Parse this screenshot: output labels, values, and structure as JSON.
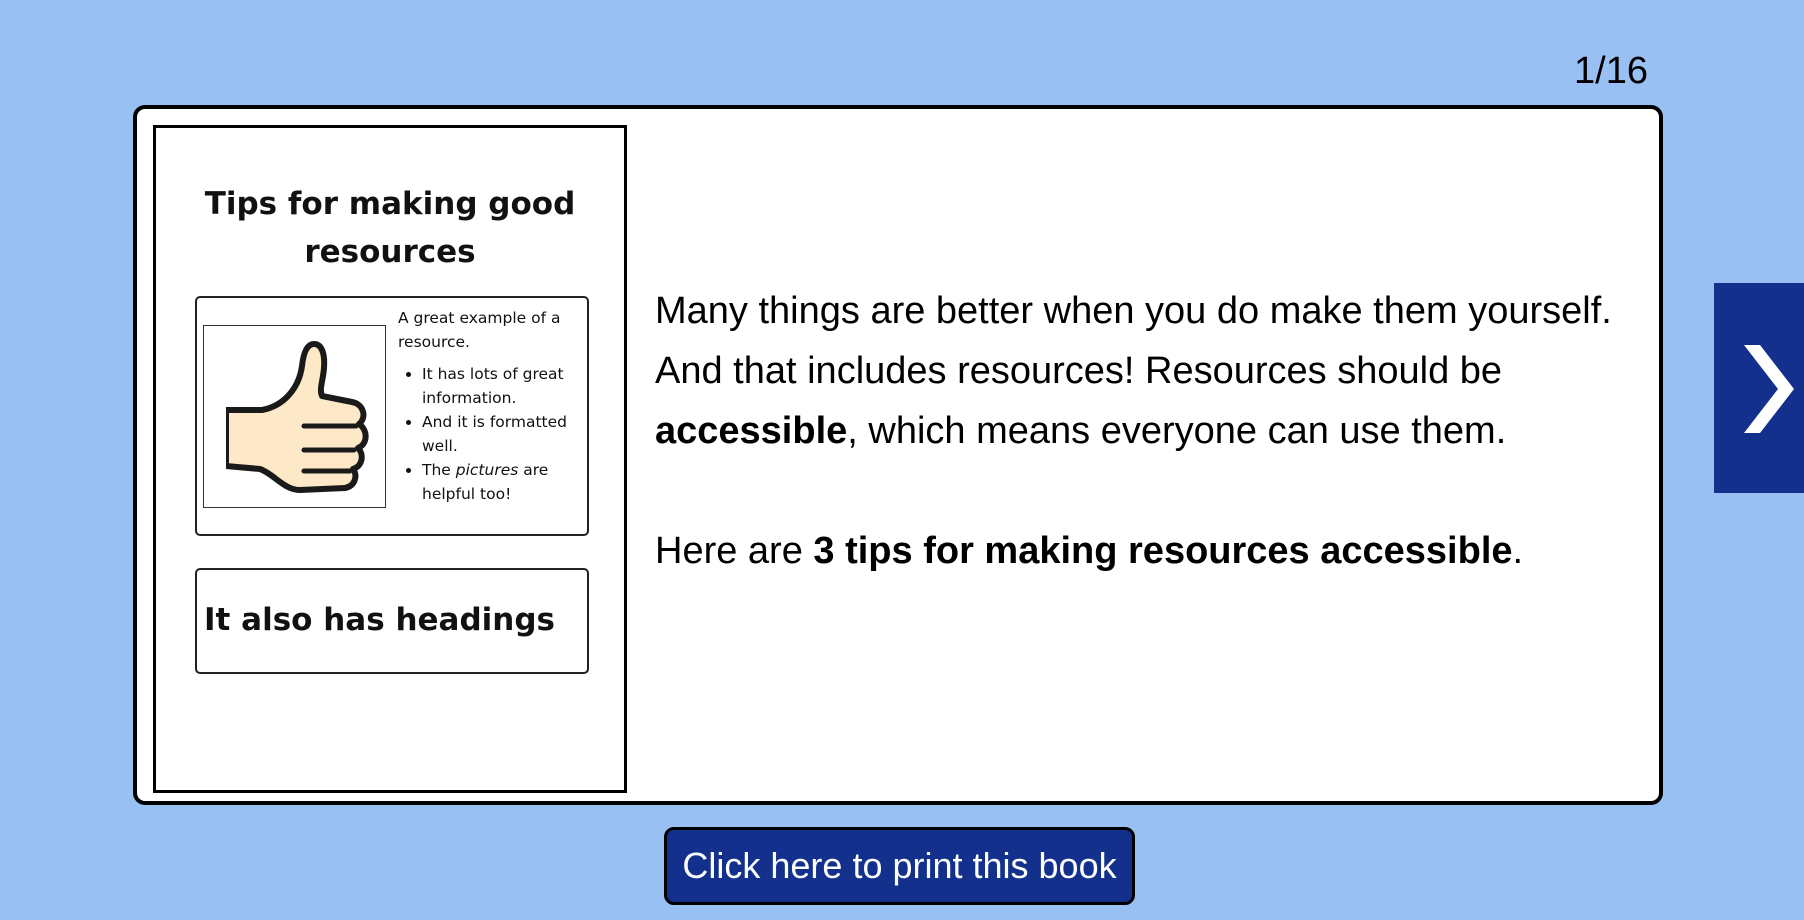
{
  "pagination": {
    "counter": "1/16"
  },
  "thumbnail": {
    "title_line1": "Tips for making good",
    "title_line2": "resources",
    "example_intro": "A great example of a resource.",
    "bullets": [
      "It has lots of great information.",
      "And it is formatted well."
    ],
    "bullet3_pre": "The ",
    "bullet3_em": "pictures",
    "bullet3_post": " are helpful too!",
    "image_icon": "thumbs-up-icon",
    "heading_text": "It also has headings"
  },
  "content": {
    "p1_a": "Many things are better when you do make them yourself. And that includes resources! Resources should be ",
    "p1_bold": "accessible",
    "p1_b": ", which means everyone can use them.",
    "p2_a": "Here are ",
    "p2_bold": "3 tips for making resources accessible",
    "p2_b": "."
  },
  "navigation": {
    "next_icon": "chevron-right-icon"
  },
  "print_button": {
    "label": "Click here to print this book"
  },
  "colors": {
    "background": "#98c0f2",
    "button": "#13318c",
    "skin": "#fde9c7"
  }
}
